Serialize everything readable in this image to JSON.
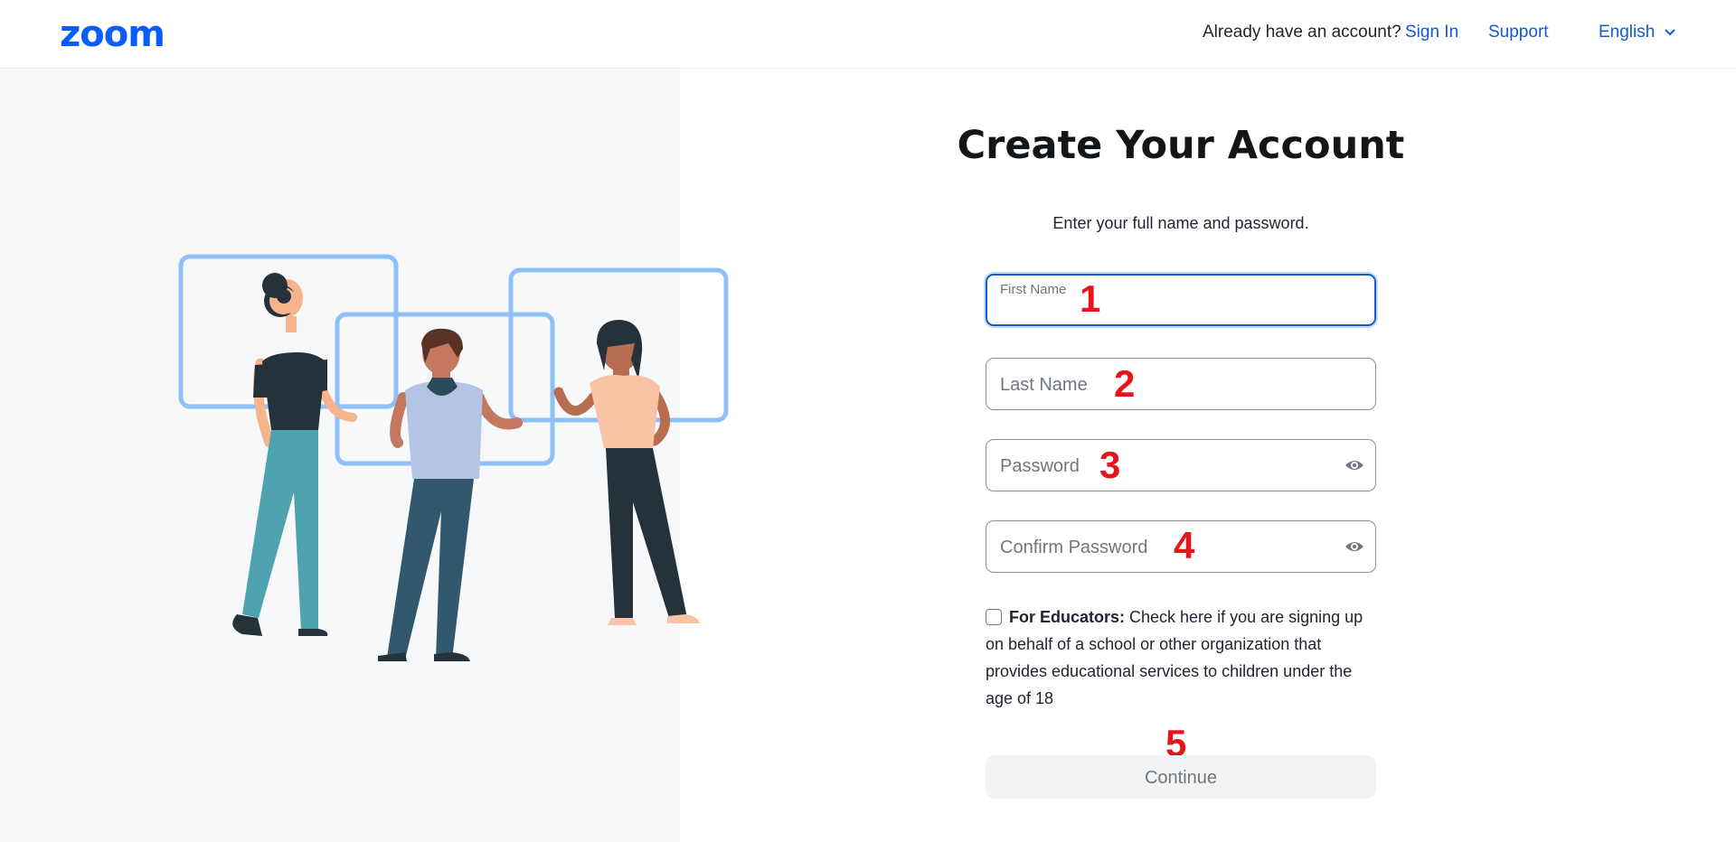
{
  "header": {
    "logo_text": "zoom",
    "already_text": "Already have an account?",
    "sign_in": "Sign In",
    "support": "Support",
    "language": "English"
  },
  "form": {
    "title": "Create Your Account",
    "subtitle": "Enter your full name and password.",
    "first_name_label": "First Name",
    "first_name_value": "",
    "last_name_placeholder": "Last Name",
    "password_placeholder": "Password",
    "confirm_password_placeholder": "Confirm Password",
    "educators_bold": "For Educators:",
    "educators_text": " Check here if you are signing up on behalf of a school or other organization that provides educational services to children under the age of 18",
    "educators_checked": false,
    "continue_label": "Continue"
  },
  "annotations": {
    "m1": "1",
    "m2": "2",
    "m3": "3",
    "m4": "4",
    "m5": "5"
  },
  "colors": {
    "brand": "#0b5cff",
    "link": "#0e5bd3",
    "marker": "#e8141c",
    "frame": "#8ec0fa"
  },
  "icons": {
    "language_dropdown": "chevron-down-icon",
    "password_toggle": "eye-icon"
  }
}
